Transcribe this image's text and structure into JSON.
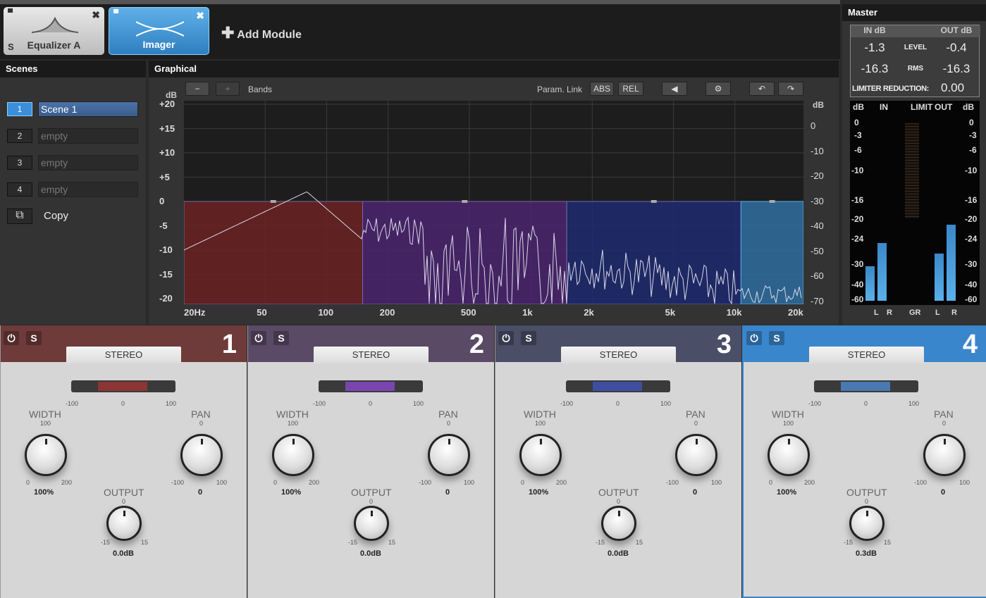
{
  "modules": {
    "items": [
      {
        "label": "Equalizer A",
        "selected": false
      },
      {
        "label": "Imager",
        "selected": true
      }
    ],
    "add_label": "Add Module"
  },
  "scenes": {
    "title": "Scenes",
    "items": [
      {
        "num": "1",
        "name": "Scene 1",
        "active": true
      },
      {
        "num": "2",
        "name": "empty"
      },
      {
        "num": "3",
        "name": "empty"
      },
      {
        "num": "4",
        "name": "empty"
      }
    ],
    "copy_label": "Copy"
  },
  "graphical": {
    "title": "Graphical",
    "minus": "−",
    "plus": "+",
    "bands_label": "Bands",
    "param_link": "Param. Link",
    "abs": "ABS",
    "rel": "REL",
    "left_unit": "dB",
    "right_unit": "dB",
    "left_ticks": [
      "+20",
      "+15",
      "+10",
      "+5",
      "0",
      "-5",
      "-10",
      "-15",
      "-20"
    ],
    "right_ticks": [
      "0",
      "-10",
      "-20",
      "-30",
      "-40",
      "-50",
      "-60",
      "-70"
    ],
    "x_ticks": [
      "20Hz",
      "50",
      "100",
      "200",
      "500",
      "1k",
      "2k",
      "5k",
      "10k",
      "20k"
    ],
    "bands": [
      {
        "from_hz": 20,
        "to_hz": 150,
        "color": "#6b2222"
      },
      {
        "from_hz": 150,
        "to_hz": 1500,
        "color": "#4b2470"
      },
      {
        "from_hz": 1500,
        "to_hz": 10700,
        "color": "#1f2a6e"
      },
      {
        "from_hz": 10700,
        "to_hz": 20000,
        "color": "#2f6fa0"
      }
    ]
  },
  "master": {
    "title": "Master",
    "in_db": "IN dB",
    "out_db": "OUT dB",
    "level": "LEVEL",
    "rms": "RMS",
    "in_level": "-1.3",
    "out_level": "-0.4",
    "in_rms": "-16.3",
    "out_rms": "-16.3",
    "limiter_label": "LIMITER REDUCTION:",
    "limiter_value": "0.00",
    "meter_headers": [
      "dB",
      "IN",
      "LIMIT",
      "OUT",
      "dB"
    ],
    "scale": [
      "0",
      "-3",
      "-6",
      "-10",
      "-16",
      "-20",
      "-24",
      "-30",
      "-40",
      "-60"
    ],
    "foot": [
      "L",
      "R",
      "GR",
      "L",
      "R"
    ]
  },
  "bands": [
    {
      "num": "1",
      "mode": "STEREO",
      "color": "#6e3a3a",
      "fill": "#8b3535",
      "width": "100%",
      "pan": "0",
      "output": "0.0dB"
    },
    {
      "num": "2",
      "mode": "STEREO",
      "color": "#5a4a66",
      "fill": "#7b45b0",
      "width": "100%",
      "pan": "0",
      "output": "0.0dB"
    },
    {
      "num": "3",
      "mode": "STEREO",
      "color": "#4a4e66",
      "fill": "#3f4ea0",
      "width": "100%",
      "pan": "0",
      "output": "0.0dB"
    },
    {
      "num": "4",
      "mode": "STEREO",
      "color": "#3a86cc",
      "fill": "#4a78b0",
      "width": "100%",
      "pan": "0",
      "output": "0.3dB",
      "selected": true
    }
  ],
  "band_labels": {
    "width": "WIDTH",
    "pan": "PAN",
    "output": "OUTPUT",
    "w_min": "0",
    "w_mid": "100",
    "w_max": "200",
    "p_min": "-100",
    "p_mid": "0",
    "p_max": "100",
    "o_min": "-15",
    "o_mid": "0",
    "o_max": "15",
    "s_min": "-100",
    "s_mid": "0",
    "s_max": "100"
  }
}
